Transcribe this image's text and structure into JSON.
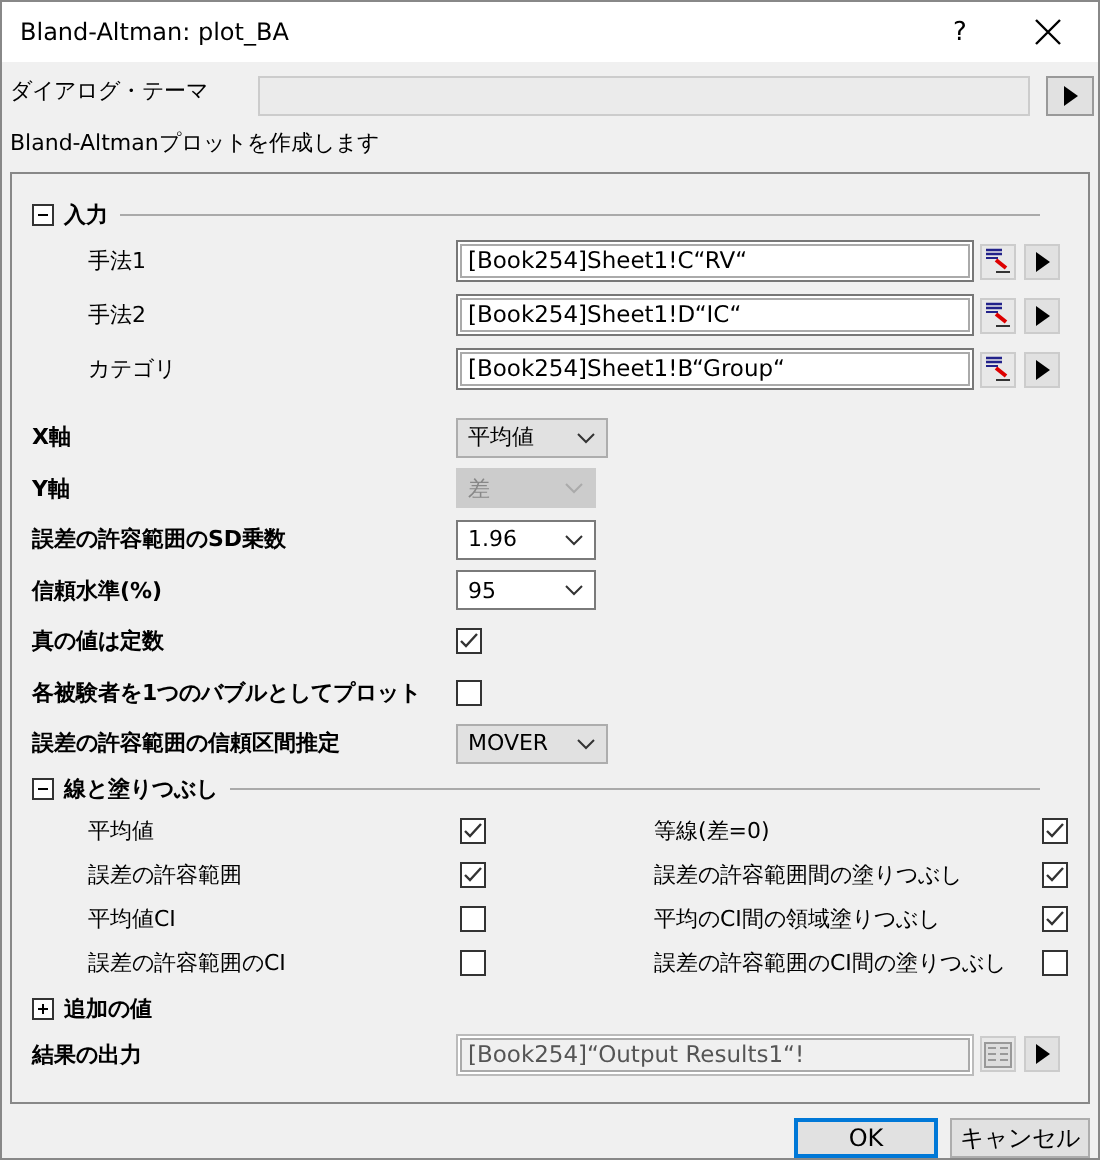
{
  "window": {
    "title": "Bland-Altman: plot_BA",
    "help": "?"
  },
  "theme": {
    "label": "ダイアログ・テーマ"
  },
  "description": "Bland-Altmanプロットを作成します",
  "input_section": {
    "title": "入力",
    "expanded": true,
    "rows": [
      {
        "label": "手法1",
        "value": "[Book254]Sheet1!C“RV“"
      },
      {
        "label": "手法2",
        "value": "[Book254]Sheet1!D“IC“"
      },
      {
        "label": "カテゴリ",
        "value": "[Book254]Sheet1!B“Group“"
      }
    ]
  },
  "settings": [
    {
      "kind": "select",
      "label": "X軸",
      "value": "平均値",
      "disabled": false,
      "wide": true
    },
    {
      "kind": "select",
      "label": "Y軸",
      "value": "差",
      "disabled": true,
      "wide": false
    },
    {
      "kind": "select",
      "label": "誤差の許容範囲のSD乗数",
      "value": "1.96",
      "disabled": false,
      "wide": false,
      "editable": true
    },
    {
      "kind": "select",
      "label": "信頼水準(%)",
      "value": "95",
      "disabled": false,
      "wide": false,
      "editable": true
    },
    {
      "kind": "checkbox",
      "label": "真の値は定数",
      "checked": true
    },
    {
      "kind": "checkbox",
      "label": "各被験者を1つのバブルとしてプロット",
      "checked": false
    },
    {
      "kind": "select",
      "label": "誤差の許容範囲の信頼区間推定",
      "value": "MOVER",
      "disabled": false,
      "wide": true
    }
  ],
  "lines_section": {
    "title": "線と塗りつぶし",
    "expanded": true,
    "items": [
      {
        "label": "平均値",
        "checked": true
      },
      {
        "label": "等線(差=0)",
        "checked": true
      },
      {
        "label": "誤差の許容範囲",
        "checked": true
      },
      {
        "label": "誤差の許容範囲間の塗りつぶし",
        "checked": true
      },
      {
        "label": "平均値CI",
        "checked": false
      },
      {
        "label": "平均のCI間の領域塗りつぶし",
        "checked": true
      },
      {
        "label": "誤差の許容範囲のCI",
        "checked": false
      },
      {
        "label": "誤差の許容範囲のCI間の塗りつぶし",
        "checked": false
      }
    ]
  },
  "extra_section": {
    "title": "追加の値",
    "expanded": false
  },
  "output": {
    "label": "結果の出力",
    "value": "[Book254]“Output Results1“!",
    "disabled": true
  },
  "buttons": [
    {
      "label": "OK",
      "default": true
    },
    {
      "label": "キャンセル",
      "default": false
    }
  ]
}
